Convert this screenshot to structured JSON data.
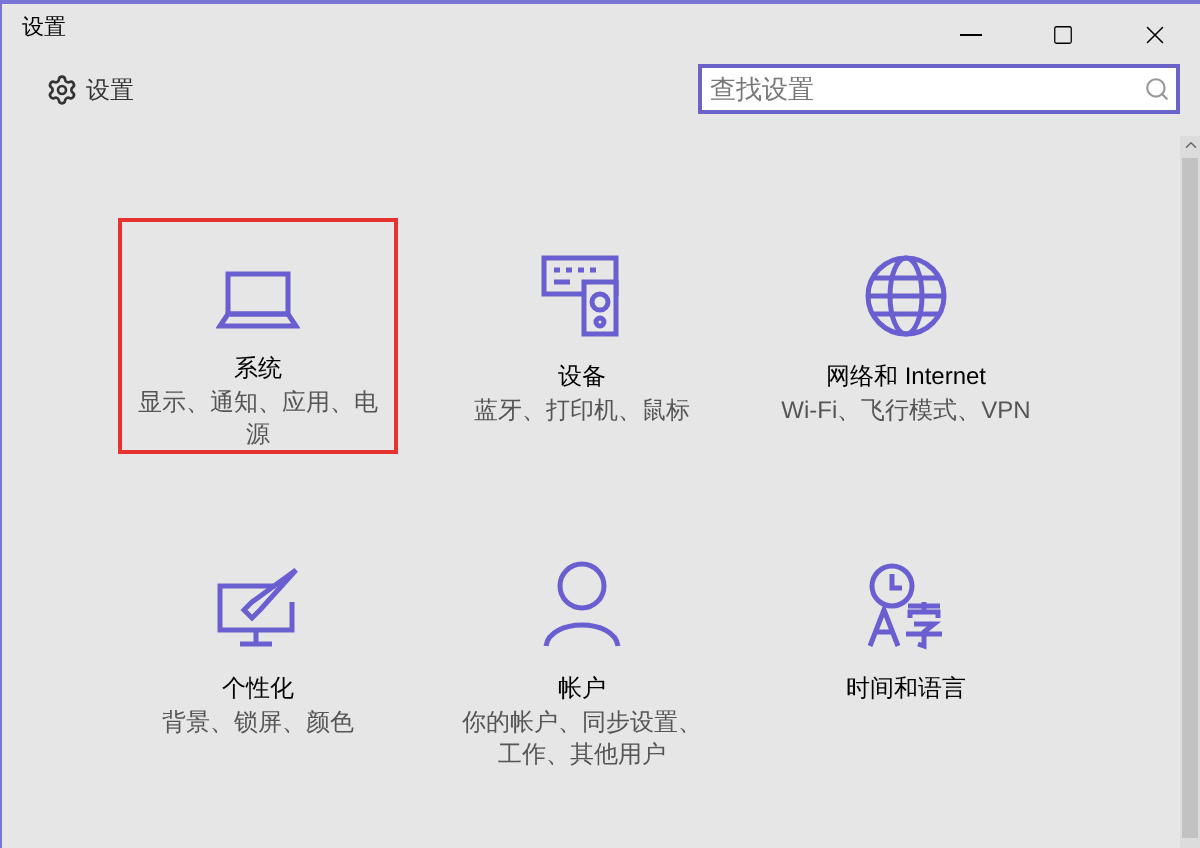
{
  "window": {
    "title": "设置"
  },
  "header": {
    "title": "设置"
  },
  "search": {
    "placeholder": "查找设置"
  },
  "tiles": [
    {
      "kind": "laptop",
      "title": "系统",
      "subtitle": "显示、通知、应用、电源",
      "selected": true
    },
    {
      "kind": "devices",
      "title": "设备",
      "subtitle": "蓝牙、打印机、鼠标",
      "selected": false
    },
    {
      "kind": "globe",
      "title": "网络和 Internet",
      "subtitle": "Wi-Fi、飞行模式、VPN",
      "selected": false
    },
    {
      "kind": "paint",
      "title": "个性化",
      "subtitle": "背景、锁屏、颜色",
      "selected": false
    },
    {
      "kind": "person",
      "title": "帐户",
      "subtitle": "你的帐户、同步设置、工作、其他用户",
      "selected": false
    },
    {
      "kind": "language",
      "title": "时间和语言",
      "selected": false
    }
  ]
}
